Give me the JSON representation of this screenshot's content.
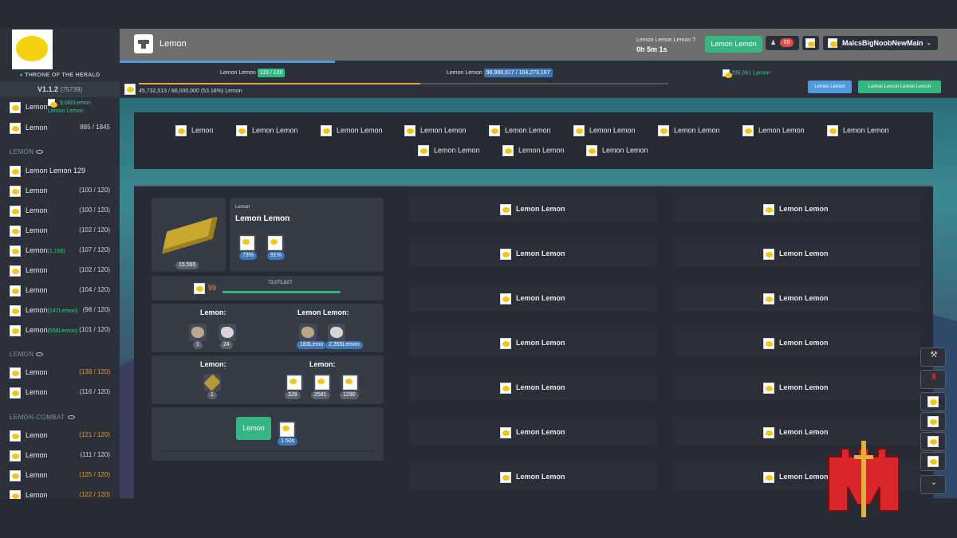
{
  "sidebar": {
    "game_name": "THRONE OF THE HERALD",
    "version": "V1.1.2",
    "version_build": "(75739)",
    "top_items": [
      {
        "label": "Lemon",
        "note": "9,060Lemon",
        "note2": "Lemon Lemon"
      },
      {
        "label": "Lemon",
        "level": "885 / 1845"
      }
    ],
    "section1": {
      "title": "LEMON",
      "items": [
        {
          "label": "Lemon Lemon 129",
          "level": ""
        },
        {
          "label": "Lemon",
          "level": "(100 / 120)"
        },
        {
          "label": "Lemon",
          "level": "(100 / 120)"
        },
        {
          "label": "Lemon",
          "level": "(102 / 120)"
        },
        {
          "label": "Lemon",
          "extra": "(1,106)",
          "level": "(107 / 120)"
        },
        {
          "label": "Lemon",
          "level": "(102 / 120)"
        },
        {
          "label": "Lemon",
          "level": "(104 / 120)"
        },
        {
          "label": "Lemon",
          "extra": "(147Lemon)",
          "level": "(98 / 120)"
        },
        {
          "label": "Lemon",
          "extra": "(556Lemon)",
          "level": "(101 / 120)"
        }
      ]
    },
    "section2": {
      "title": "LEMON",
      "items": [
        {
          "label": "Lemon",
          "level": "(138 / 120)",
          "orange": true
        },
        {
          "label": "Lemon",
          "level": "(116 / 120)"
        }
      ]
    },
    "section3": {
      "title": "LEMON-COMBAT",
      "items": [
        {
          "label": "Lemon",
          "level": "(121 / 120)",
          "orange": true
        },
        {
          "label": "Lemon",
          "level": "(111 / 120)"
        },
        {
          "label": "Lemon",
          "level": "(125 / 120)",
          "orange": true
        },
        {
          "label": "Lemon",
          "level": "(122 / 120)",
          "orange": true
        }
      ]
    }
  },
  "header": {
    "title": "Lemon",
    "timer_label": "Lemon Lemon Lemon",
    "timer_value": "0h 5m 1s",
    "green_button": "Lemon Lemon",
    "notif_count": "69",
    "username": "MalcsBigNoobNewMain"
  },
  "strip": {
    "skill_label": "Lemon Lemon",
    "skill_level": "119 / 120",
    "xp_label": "Lemon Lemon",
    "xp_value": "96,996,617 / 104,273,167",
    "gold_value": "295,061 Lemon",
    "progress_text": "45,732,513 / 86,000,000 (53.18%) Lemon",
    "progress_fraction": 0.5318,
    "btn_a": "Lemon Lemon",
    "btn_b": "Lemon Lemon Lemon Lemon"
  },
  "tabs_row1": [
    "Lemon",
    "Lemon Lemon",
    "Lemon Lemon",
    "Lemon Lemon",
    "Lemon Lemon",
    "Lemon Lemon",
    "Lemon Lemon",
    "Lemon Lemon",
    "Lemon Lemon"
  ],
  "tabs_row2": [
    "Lemon Lemon",
    "Lemon Lemon",
    "Lemon Lemon"
  ],
  "item": {
    "quantity": "15,565",
    "category": "Lemon",
    "name": "Lemon Lemon",
    "bonus1": "73%",
    "bonus2": "91%",
    "level_req": "99",
    "xp": "73,073,827",
    "materials_label": "Lemon:",
    "materials": [
      "1",
      "24"
    ],
    "owned_label": "Lemon Lemon:",
    "owned": [
      "183Lemo",
      "2,355Lemon"
    ],
    "tools_label": "Lemon:",
    "tools": [
      "1"
    ],
    "outputs_label": "Lemon:",
    "outputs": [
      "328",
      "2581",
      "1290"
    ],
    "craft_label": "Lemon",
    "craft_time": "1.50s"
  },
  "recipes_left": [
    "Lemon Lemon",
    "Lemon Lemon",
    "Lemon Lemon",
    "Lemon Lemon",
    "Lemon Lemon",
    "Lemon Lemon",
    "Lemon Lemon"
  ],
  "recipes_right": [
    "Lemon Lemon",
    "Lemon Lemon",
    "Lemon Lemon",
    "Lemon Lemon",
    "Lemon Lemon",
    "Lemon Lemon",
    "Lemon Lemon"
  ],
  "colors": {
    "accent_green": "#35b580",
    "accent_blue": "#4f9be0",
    "level_orange": "#e39b2c",
    "watermark_red": "#d8262b"
  }
}
